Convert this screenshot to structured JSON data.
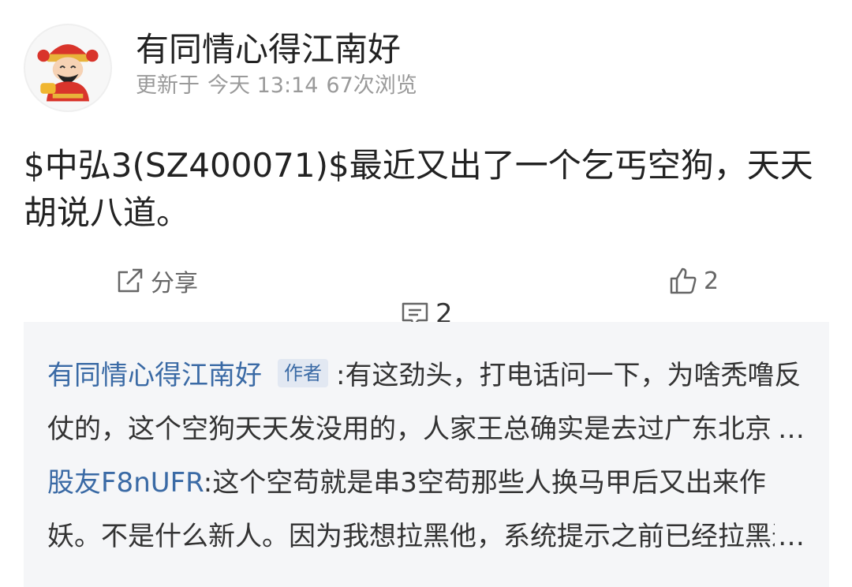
{
  "post": {
    "author": "有同情心得江南好",
    "updated_label": "更新于",
    "updated_time": "今天 13:14",
    "views": "67次浏览",
    "body_stock": "$中弘3(SZ400071)$",
    "body_text": "最近又出了一个乞丐空狗，天天胡说八道。"
  },
  "actions": {
    "share_label": "分享",
    "comment_count": "2",
    "like_count": "2"
  },
  "comments": [
    {
      "author": "有同情心得江南好",
      "badge": "作者",
      "text": ":有这劲头，打电话问一下，为啥秃噜反仗的，这个空狗天天发没用的，人家王总确实是去过广东北京的，这么大的事情不是一时半会的"
    },
    {
      "author": "股友F8nUFR",
      "badge": "",
      "text": ":这个空苟就是串3空苟那些人换马甲后又出来作妖。不是什么新人。因为我想拉黑他，系统提示之前已经拉黑过了"
    }
  ],
  "ellipsis": "…",
  "colors": {
    "link": "#3a6aa5",
    "meta": "#9a9a9a",
    "comment_bg": "#f5f6f8"
  },
  "icons": [
    "share-icon",
    "comment-icon",
    "thumbs-up-icon",
    "avatar-caishen"
  ]
}
